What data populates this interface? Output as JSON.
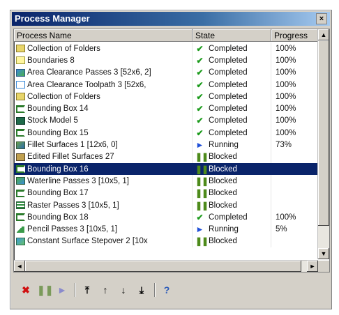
{
  "window": {
    "title": "Process Manager",
    "close_glyph": "×"
  },
  "columns": {
    "name": "Process Name",
    "state": "State",
    "progress": "Progress"
  },
  "colors": {
    "selection": "#0a246a",
    "completed": "#1a9a1a",
    "running": "#1f4fd8",
    "blocked": "#4d8a1a"
  },
  "rows": [
    {
      "icon": "folder-icon",
      "name": "Collection of Folders",
      "state": "Completed",
      "progress": "100%"
    },
    {
      "icon": "boundary-icon",
      "name": "Boundaries 8",
      "state": "Completed",
      "progress": "100%"
    },
    {
      "icon": "toolpath-icon",
      "name": "Area Clearance Passes 3 [52x6, 2]",
      "state": "Completed",
      "progress": "100%"
    },
    {
      "icon": "toolpath-outline-icon",
      "name": "Area Clearance Toolpath 3 [52x6,",
      "state": "Completed",
      "progress": "100%"
    },
    {
      "icon": "folder-icon",
      "name": "Collection of Folders",
      "state": "Completed",
      "progress": "100%"
    },
    {
      "icon": "bounding-box-icon",
      "name": "Bounding Box 14",
      "state": "Completed",
      "progress": "100%"
    },
    {
      "icon": "stock-model-icon",
      "name": "Stock Model 5",
      "state": "Completed",
      "progress": "100%"
    },
    {
      "icon": "bounding-box-icon",
      "name": "Bounding Box 15",
      "state": "Completed",
      "progress": "100%"
    },
    {
      "icon": "fillet-icon",
      "name": "Fillet Surfaces 1 [12x6, 0]",
      "state": "Running",
      "progress": "73%"
    },
    {
      "icon": "edited-fillet-icon",
      "name": "Edited Fillet Surfaces 27",
      "state": "Blocked",
      "progress": ""
    },
    {
      "icon": "bounding-box-icon",
      "name": "Bounding Box 16",
      "state": "Blocked",
      "progress": "",
      "selected": true
    },
    {
      "icon": "waterline-icon",
      "name": "Waterline Passes 3 [10x5, 1]",
      "state": "Blocked",
      "progress": ""
    },
    {
      "icon": "bounding-box-icon",
      "name": "Bounding Box 17",
      "state": "Blocked",
      "progress": ""
    },
    {
      "icon": "raster-icon",
      "name": "Raster Passes 3 [10x5, 1]",
      "state": "Blocked",
      "progress": ""
    },
    {
      "icon": "bounding-box-icon",
      "name": "Bounding Box 18",
      "state": "Completed",
      "progress": "100%"
    },
    {
      "icon": "pencil-icon",
      "name": "Pencil Passes 3 [10x5, 1]",
      "state": "Running",
      "progress": "5%"
    },
    {
      "icon": "constant-surface-icon",
      "name": "Constant Surface Stepover 2 [10x",
      "state": "Blocked",
      "progress": ""
    }
  ],
  "toolbar": [
    {
      "icon": "cancel-icon",
      "glyph": "✖",
      "color": "#d01010"
    },
    {
      "icon": "pause-icon",
      "glyph": "❚❚",
      "color": "#7a9a5a"
    },
    {
      "icon": "play-icon",
      "glyph": "►",
      "color": "#8a8acc"
    },
    {
      "icon": "move-top-icon",
      "glyph": "⤒",
      "color": "#000000"
    },
    {
      "icon": "move-up-icon",
      "glyph": "↑",
      "color": "#000000"
    },
    {
      "icon": "move-down-icon",
      "glyph": "↓",
      "color": "#000000"
    },
    {
      "icon": "move-bottom-icon",
      "glyph": "⤓",
      "color": "#000000"
    },
    {
      "icon": "help-icon",
      "glyph": "?",
      "color": "#2a5ab8"
    }
  ]
}
